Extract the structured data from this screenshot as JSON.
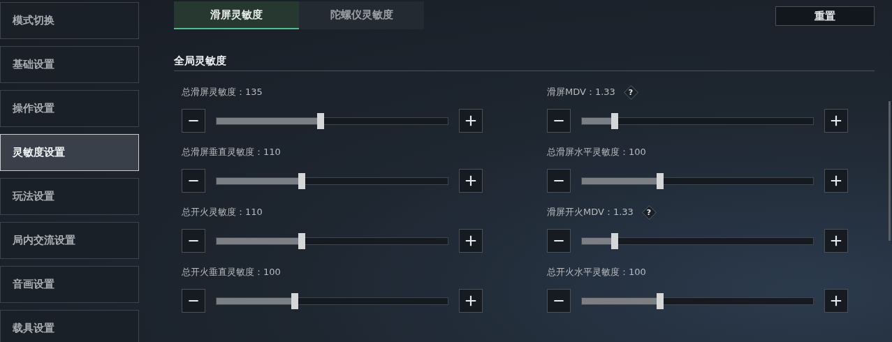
{
  "sidebar": {
    "items": [
      {
        "label": "模式切换",
        "selected": false
      },
      {
        "label": "基础设置",
        "selected": false
      },
      {
        "label": "操作设置",
        "selected": false
      },
      {
        "label": "灵敏度设置",
        "selected": true
      },
      {
        "label": "玩法设置",
        "selected": false
      },
      {
        "label": "局内交流设置",
        "selected": false
      },
      {
        "label": "音画设置",
        "selected": false
      },
      {
        "label": "载具设置",
        "selected": false
      }
    ]
  },
  "tabs": [
    {
      "label": "滑屏灵敏度",
      "selected": true
    },
    {
      "label": "陀螺仪灵敏度",
      "selected": false
    }
  ],
  "reset_button": "重置",
  "section": {
    "title": "全局灵敏度",
    "sliders": [
      {
        "label": "总滑屏灵敏度：135",
        "level": 0.45
      },
      {
        "label": "滑屏MDV：1.33",
        "help": "?",
        "level": 0.145
      },
      {
        "label": "总滑屏垂直灵敏度：110",
        "level": 0.37
      },
      {
        "label": "总滑屏水平灵敏度：100",
        "level": 0.34
      },
      {
        "label": "总开火灵敏度：110",
        "level": 0.37
      },
      {
        "label": "滑屏开火MDV：1.33",
        "help": "?",
        "level": 0.145
      },
      {
        "label": "总开火垂直灵敏度：100",
        "level": 0.34
      },
      {
        "label": "总开火水平灵敏度：100",
        "level": 0.34
      }
    ]
  }
}
